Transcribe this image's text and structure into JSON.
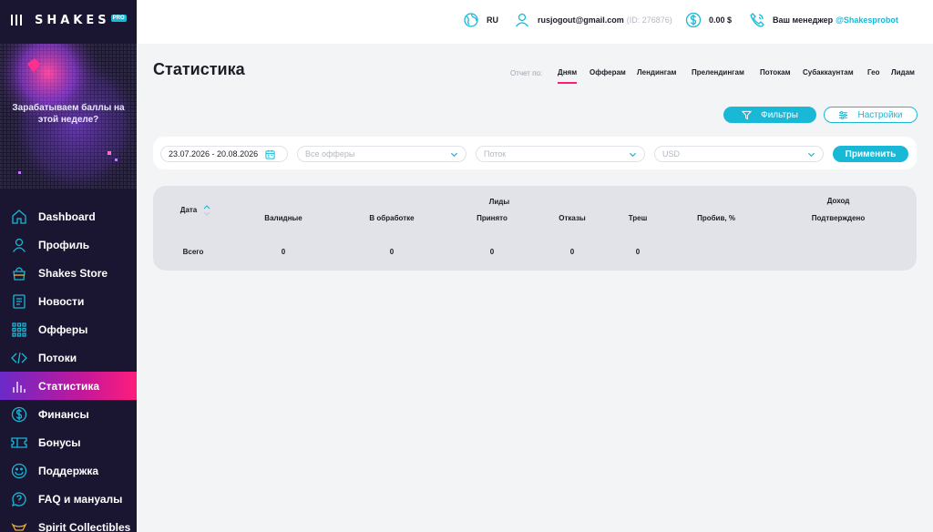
{
  "brand": {
    "logo_text": "SHAKES",
    "badge": "PRO"
  },
  "promo": {
    "text": "Зарабатываем баллы на этой неделе?"
  },
  "sidebar": {
    "items": [
      {
        "label": "Dashboard",
        "icon": "home-icon"
      },
      {
        "label": "Профиль",
        "icon": "user-icon"
      },
      {
        "label": "Shakes Store",
        "icon": "bag-icon"
      },
      {
        "label": "Новости",
        "icon": "news-icon"
      },
      {
        "label": "Офферы",
        "icon": "grid-icon"
      },
      {
        "label": "Потоки",
        "icon": "code-icon"
      },
      {
        "label": "Статистика",
        "icon": "bar-chart-icon",
        "active": true
      },
      {
        "label": "Финансы",
        "icon": "dollar-icon"
      },
      {
        "label": "Бонусы",
        "icon": "ticket-icon"
      },
      {
        "label": "Поддержка",
        "icon": "support-icon"
      },
      {
        "label": "FAQ и мануалы",
        "icon": "help-icon"
      },
      {
        "label": "Spirit Collectibles",
        "icon": "crown-icon"
      }
    ]
  },
  "header": {
    "language": "RU",
    "email": "rusjogout@gmail.com",
    "user_id": "(ID: 276876)",
    "balance": "0.00 $",
    "manager_label": "Ваш менеджер",
    "manager_handle": "@Shakesprobot"
  },
  "page": {
    "title": "Статистика"
  },
  "report": {
    "label": "Отчет по:",
    "tabs": [
      "Дням",
      "Офферам",
      "Лендингам",
      "Прелендингам",
      "Потокам",
      "Субаккаунтам",
      "Гео",
      "Лидам"
    ],
    "active_tab": "Дням"
  },
  "actions": {
    "filters": "Фильтры",
    "settings": "Настройки"
  },
  "filters": {
    "date_range": "23.07.2026 - 20.08.2026",
    "offers_placeholder": "Все офферы",
    "stream_placeholder": "Поток",
    "currency": "USD",
    "apply": "Применить"
  },
  "table": {
    "headers": {
      "date": "Дата",
      "leads_group": "Лиды",
      "income_group": "Доход",
      "valid": "Валидные",
      "processing": "В обработке",
      "accepted": "Принято",
      "rejected": "Отказы",
      "trash": "Треш",
      "breakthrough": "Пробив, %",
      "confirmed": "Подтверждено"
    },
    "total_row": {
      "label": "Всего",
      "valid": "0",
      "processing": "0",
      "accepted": "0",
      "rejected": "0",
      "trash": "0"
    }
  },
  "colors": {
    "accent": "#19b8d6",
    "active": "#ff1c7c",
    "sidebar": "#1a1530"
  }
}
